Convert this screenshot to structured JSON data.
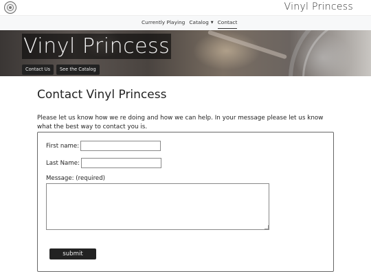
{
  "header": {
    "brand": "Vinyl Princess",
    "logo_icon": "vinyl-record-icon"
  },
  "nav": {
    "items": [
      {
        "label": "Currently Playing"
      },
      {
        "label": "Catalog",
        "has_dropdown": true
      },
      {
        "label": "Contact",
        "active": true
      }
    ]
  },
  "hero": {
    "title": "Vinyl Princess",
    "buttons": [
      {
        "label": "Contact Us"
      },
      {
        "label": "See the Catalog"
      }
    ]
  },
  "main": {
    "title": "Contact Vinyl Princess",
    "intro": "Please let us know how we re doing and how we can help. In your message please let us know what the best way to contact you is."
  },
  "form": {
    "first_name_label": "First name:",
    "first_name_value": "",
    "last_name_label": "Last Name:",
    "last_name_value": "",
    "message_label": "Message: (required)",
    "message_value": "",
    "submit_label": "submit"
  }
}
